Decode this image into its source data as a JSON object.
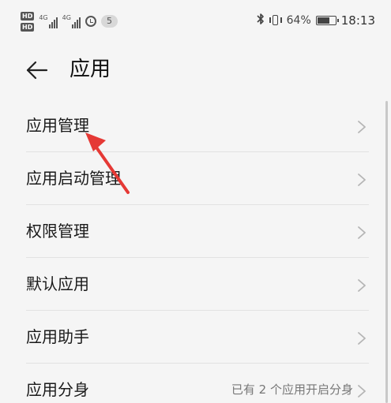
{
  "status_bar": {
    "hd1": "HD",
    "hd2": "HD",
    "net1": "4G",
    "net2": "4G",
    "notification_count": "5",
    "battery_percent": "64%",
    "time": "18:13",
    "icons": [
      "bluetooth-icon",
      "vibrate-icon",
      "battery-icon",
      "alarm-icon"
    ]
  },
  "header": {
    "title": "应用",
    "back_icon": "back-arrow-icon"
  },
  "items": [
    {
      "label": "应用管理",
      "value": ""
    },
    {
      "label": "应用启动管理",
      "value": ""
    },
    {
      "label": "权限管理",
      "value": ""
    },
    {
      "label": "默认应用",
      "value": ""
    },
    {
      "label": "应用助手",
      "value": ""
    },
    {
      "label": "应用分身",
      "value": "已有 2 个应用开启分身"
    }
  ],
  "colors": {
    "background": "#f5f5f5",
    "annotation_arrow": "#e53935"
  }
}
